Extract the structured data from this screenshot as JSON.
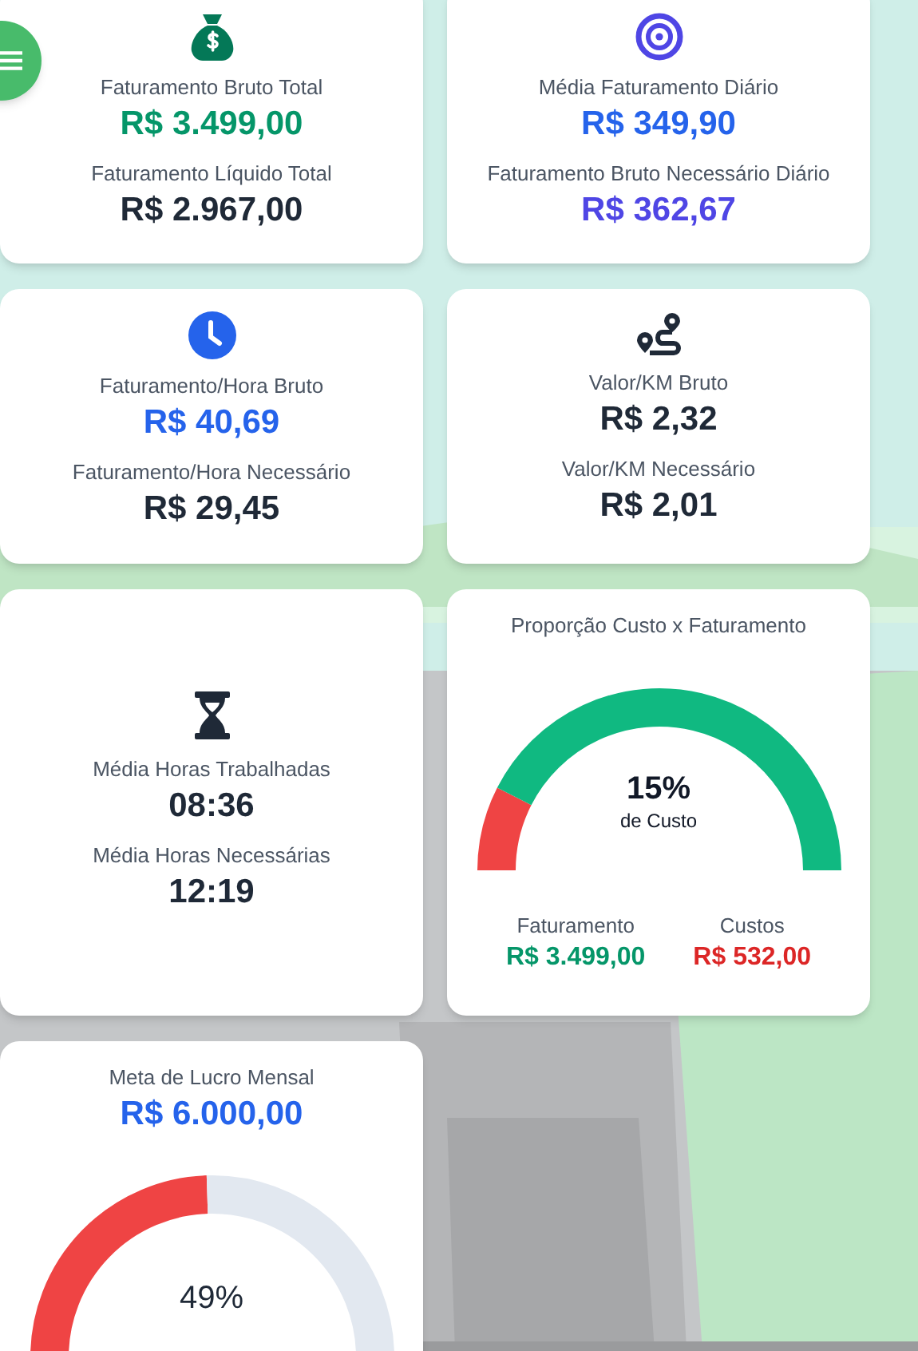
{
  "card_rows": [
    {
      "cards": [
        {
          "kind": "metric",
          "rows": [
            {
              "label": "Faturamento Bruto Total",
              "value": "R$ 3.499,00",
              "color": "#059669"
            },
            {
              "label": "Faturamento Líquido Total",
              "value": "R$ 2.967,00",
              "color": "#1f2937"
            }
          ]
        },
        {
          "kind": "metric",
          "rows": [
            {
              "label": "Média Faturamento Diário",
              "value": "R$ 349,90",
              "color": "#2563eb"
            },
            {
              "label": "Faturamento Bruto Necessário Diário",
              "value": "R$ 362,67",
              "color": "#4f46e5"
            }
          ]
        }
      ]
    },
    {
      "cards": [
        {
          "kind": "metric",
          "rows": [
            {
              "label": "Faturamento/Hora Bruto",
              "value": "R$ 40,69",
              "color": "#2563eb"
            },
            {
              "label": "Faturamento/Hora Necessário",
              "value": "R$ 29,45",
              "color": "#1f2937"
            }
          ]
        },
        {
          "kind": "metric",
          "rows": [
            {
              "label": "Valor/KM Bruto",
              "value": "R$ 2,32",
              "color": "#1f2937"
            },
            {
              "label": "Valor/KM Necessário",
              "value": "R$ 2,01",
              "color": "#1f2937"
            }
          ]
        }
      ]
    },
    {
      "cards": [
        {
          "kind": "metric",
          "rows": [
            {
              "label": "Média Horas Trabalhadas",
              "value": "08:36",
              "color": "#1f2937"
            },
            {
              "label": "Média Horas Necessárias",
              "value": "12:19",
              "color": "#1f2937"
            }
          ]
        },
        {
          "kind": "gauge",
          "title": "Proporção Custo x Faturamento",
          "center_value": "15%",
          "center_caption": "de Custo",
          "legend": [
            {
              "label": "Faturamento",
              "value": "R$ 3.499,00",
              "color": "#059669"
            },
            {
              "label": "Custos",
              "value": "R$ 532,00",
              "color": "#dc2626"
            }
          ]
        }
      ]
    },
    {
      "cards": [
        {
          "kind": "goal",
          "title": "Meta de Lucro Mensal",
          "value": "R$ 6.000,00",
          "center_value": "49%"
        }
      ]
    }
  ]
}
